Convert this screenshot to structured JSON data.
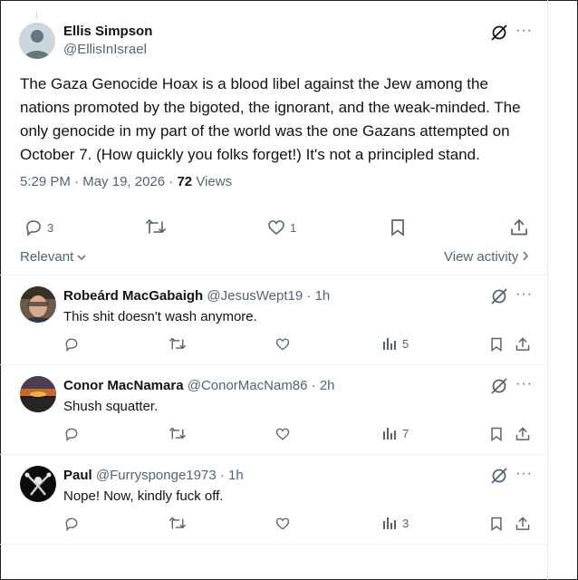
{
  "tweet": {
    "author_name": "Ellis Simpson",
    "author_handle": "@EllisInIsrael",
    "text": "The Gaza Genocide Hoax is a blood libel against the Jew among the nations promoted by the bigoted, the ignorant, and the weak-minded. The only genocide in my part of the world was the one Gazans attempted on October 7. (How quickly you folks forget!) It's not a principled stand.",
    "time": "5:29 PM",
    "date": "May 19, 2026",
    "views_count": "72",
    "views_label": "Views",
    "reply_count": "3",
    "like_count": "1",
    "more": "···"
  },
  "sort": {
    "label": "Relevant",
    "view_activity": "View activity"
  },
  "replies": [
    {
      "name": "Robeárd MacGabaigh",
      "handle": "@JesusWept19",
      "age": "1h",
      "text": "This shit doesn't wash anymore.",
      "views": "5"
    },
    {
      "name": "Conor MacNamara",
      "handle": "@ConorMacNam86",
      "age": "2h",
      "text": "Shush squatter.",
      "views": "7"
    },
    {
      "name": "Paul",
      "handle": "@Furrysponge1973",
      "age": "1h",
      "text": "Nope! Now, kindly fuck off.",
      "views": "3"
    }
  ],
  "icons": {
    "grok": "grok-icon",
    "more": "more-icon",
    "reply": "reply-icon",
    "retweet": "retweet-icon",
    "like": "like-icon",
    "bookmark": "bookmark-icon",
    "share": "share-icon",
    "views": "views-icon",
    "chevron": "chevron-down-icon",
    "chevron_right": "chevron-right-icon"
  },
  "colors": {
    "text": "#0f1419",
    "muted": "#536471",
    "border": "#eff3f4"
  }
}
